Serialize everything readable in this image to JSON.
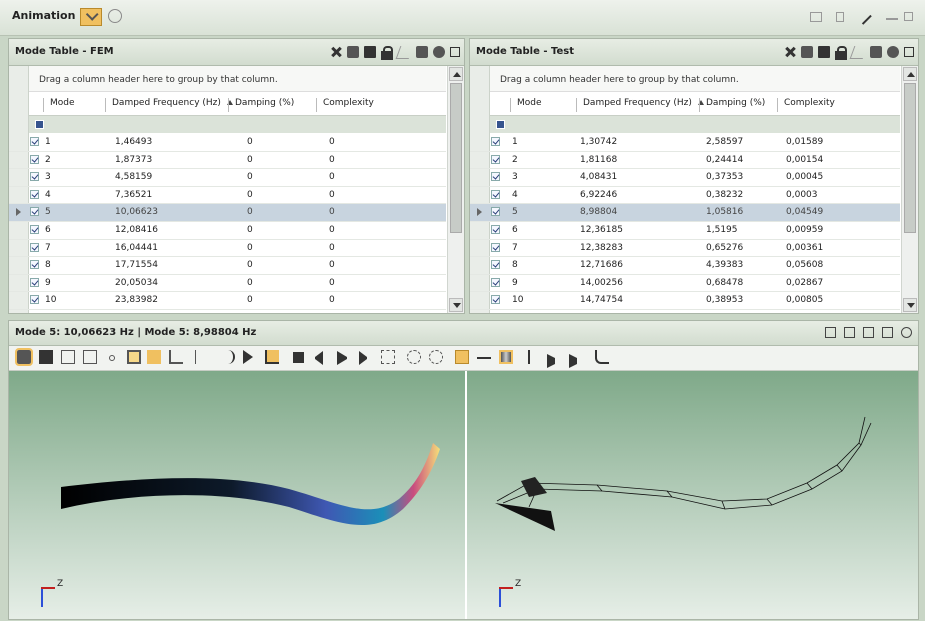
{
  "app": {
    "title": "Animation"
  },
  "fem": {
    "title": "Mode Table - FEM",
    "grouping_hint": "Drag a column header here to group by that column.",
    "columns": [
      "Mode",
      "Damped Frequency (Hz)",
      "Damping (%)",
      "Complexity"
    ],
    "rows": [
      {
        "mode": "1",
        "freq": "1,46493",
        "damping": "0",
        "complexity": "0"
      },
      {
        "mode": "2",
        "freq": "1,87373",
        "damping": "0",
        "complexity": "0"
      },
      {
        "mode": "3",
        "freq": "4,58159",
        "damping": "0",
        "complexity": "0"
      },
      {
        "mode": "4",
        "freq": "7,36521",
        "damping": "0",
        "complexity": "0"
      },
      {
        "mode": "5",
        "freq": "10,06623",
        "damping": "0",
        "complexity": "0"
      },
      {
        "mode": "6",
        "freq": "12,08416",
        "damping": "0",
        "complexity": "0"
      },
      {
        "mode": "7",
        "freq": "16,04441",
        "damping": "0",
        "complexity": "0"
      },
      {
        "mode": "8",
        "freq": "17,71554",
        "damping": "0",
        "complexity": "0"
      },
      {
        "mode": "9",
        "freq": "20,05034",
        "damping": "0",
        "complexity": "0"
      },
      {
        "mode": "10",
        "freq": "23,83982",
        "damping": "0",
        "complexity": "0"
      }
    ]
  },
  "test": {
    "title": "Mode Table - Test",
    "grouping_hint": "Drag a column header here to group by that column.",
    "columns": [
      "Mode",
      "Damped Frequency (Hz)",
      "Damping (%)",
      "Complexity"
    ],
    "rows": [
      {
        "mode": "1",
        "freq": "1,30742",
        "damping": "2,58597",
        "complexity": "0,01589"
      },
      {
        "mode": "2",
        "freq": "1,81168",
        "damping": "0,24414",
        "complexity": "0,00154"
      },
      {
        "mode": "3",
        "freq": "4,08431",
        "damping": "0,37353",
        "complexity": "0,00045"
      },
      {
        "mode": "4",
        "freq": "6,92246",
        "damping": "0,38232",
        "complexity": "0,0003"
      },
      {
        "mode": "5",
        "freq": "8,98804",
        "damping": "1,05816",
        "complexity": "0,04549"
      },
      {
        "mode": "6",
        "freq": "12,36185",
        "damping": "1,5195",
        "complexity": "0,00959"
      },
      {
        "mode": "7",
        "freq": "12,38283",
        "damping": "0,65276",
        "complexity": "0,00361"
      },
      {
        "mode": "8",
        "freq": "12,71686",
        "damping": "4,39383",
        "complexity": "0,05608"
      },
      {
        "mode": "9",
        "freq": "14,00256",
        "damping": "0,68478",
        "complexity": "0,02867"
      },
      {
        "mode": "10",
        "freq": "14,74754",
        "damping": "0,38953",
        "complexity": "0,00805"
      }
    ]
  },
  "viewer": {
    "title": "Mode 5: 10,06623 Hz | Mode 5: 8,98804 Hz",
    "axis_label": "Z"
  },
  "colors": {
    "accent": "#f0c060",
    "selected_row": "#c8d4df",
    "viewport_top": "#7fa989",
    "viewport_bottom": "#e6eee7"
  }
}
